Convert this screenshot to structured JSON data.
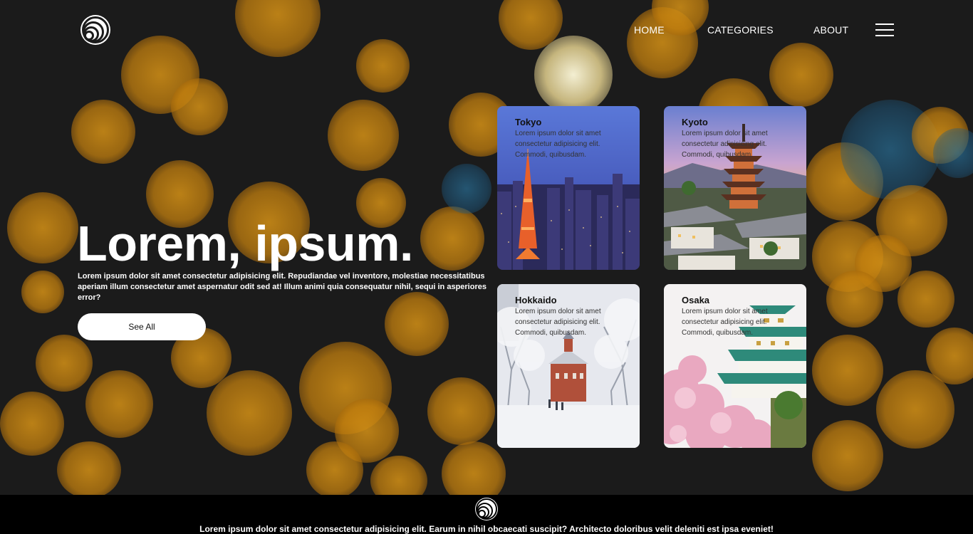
{
  "nav": {
    "items": [
      {
        "label": "HOME"
      },
      {
        "label": "CATEGORIES"
      },
      {
        "label": "ABOUT"
      }
    ],
    "menu_icon": "hamburger-menu-icon",
    "logo_icon": "concentric-rings-logo-icon"
  },
  "hero": {
    "title": "Lorem, ipsum.",
    "text": "Lorem ipsum dolor sit amet consectetur adipisicing elit. Repudiandae vel inventore, molestiae necessitatibus aperiam illum consectetur amet aspernatur odit sed at! Illum animi quia consequatur nihil, sequi in asperiores error?",
    "button_label": "See All"
  },
  "cards": [
    {
      "title": "Tokyo",
      "desc": "Lorem ipsum dolor sit amet consectetur adipisicing elit. Commodi, quibusdam."
    },
    {
      "title": "Kyoto",
      "desc": "Lorem ipsum dolor sit amet consectetur adipisicing elit. Commodi, quibusdam."
    },
    {
      "title": "Hokkaido",
      "desc": "Lorem ipsum dolor sit amet consectetur adipisicing elit. Commodi, quibusdam."
    },
    {
      "title": "Osaka",
      "desc": "Lorem ipsum dolor sit amet consectetur adipisicing elit. Commodi, quibusdam."
    }
  ],
  "footer": {
    "text": "Lorem ipsum dolor sit amet consectetur adipisicing elit. Earum in nihil obcaecati suscipit? Architecto doloribus velit deleniti est ipsa eveniet!"
  },
  "colors": {
    "background": "#1b1b1b",
    "bokeh": "#d6921a",
    "footer": "#000000",
    "button": "#ffffff"
  }
}
